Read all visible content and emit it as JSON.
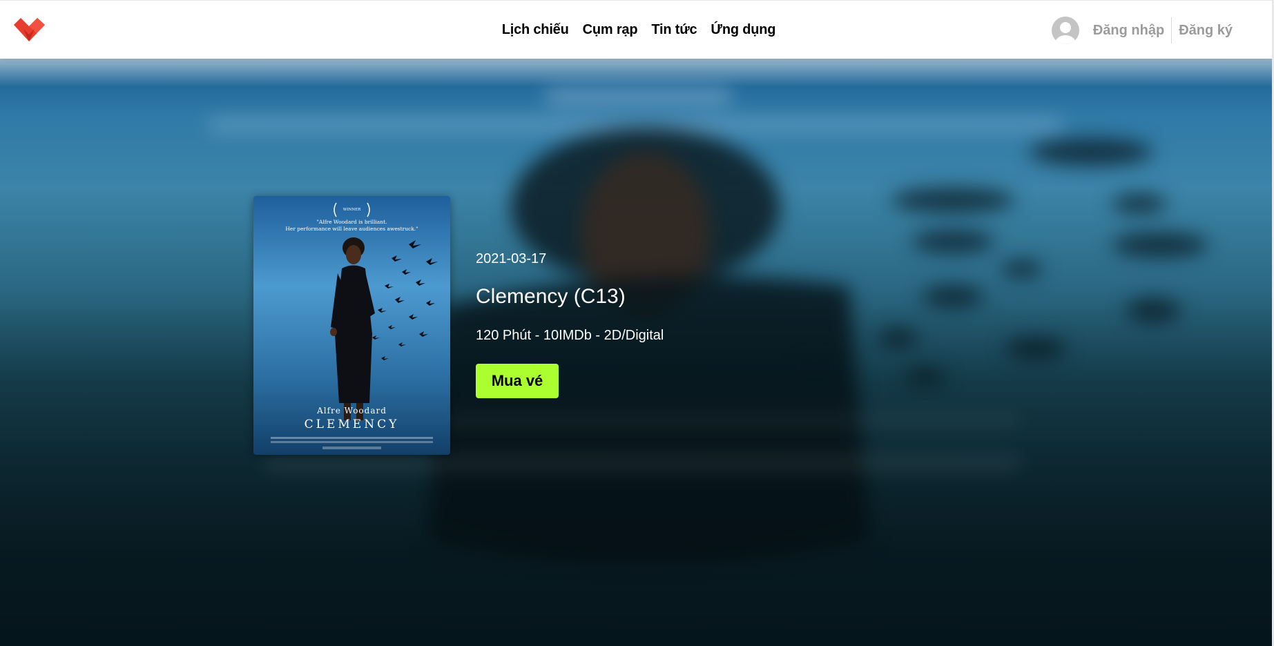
{
  "header": {
    "logo_icon": "heart-logo-icon",
    "nav": [
      {
        "label": "Lịch chiếu"
      },
      {
        "label": "Cụm rạp"
      },
      {
        "label": "Tin tức"
      },
      {
        "label": "Ứng dụng"
      }
    ],
    "avatar_icon": "user-avatar-icon",
    "login_label": "Đăng nhập",
    "register_label": "Đăng ký"
  },
  "movie": {
    "release_date": "2021-03-17",
    "title": "Clemency (C13)",
    "meta": "120 Phút - 10IMDb - 2D/Digital",
    "buy_label": "Mua vé",
    "poster": {
      "award": "WINNER",
      "quote_line1": "\"Alfre Woodard is brilliant.",
      "quote_line2": "Her performance will leave audiences awestruck.\"",
      "actor": "Alfre Woodard",
      "film_title": "CLEMENCY"
    }
  },
  "colors": {
    "accent": "#acff2f",
    "logo_red": "#e73c2e",
    "nav_text": "#000000",
    "auth_text": "#9b9b9b"
  }
}
